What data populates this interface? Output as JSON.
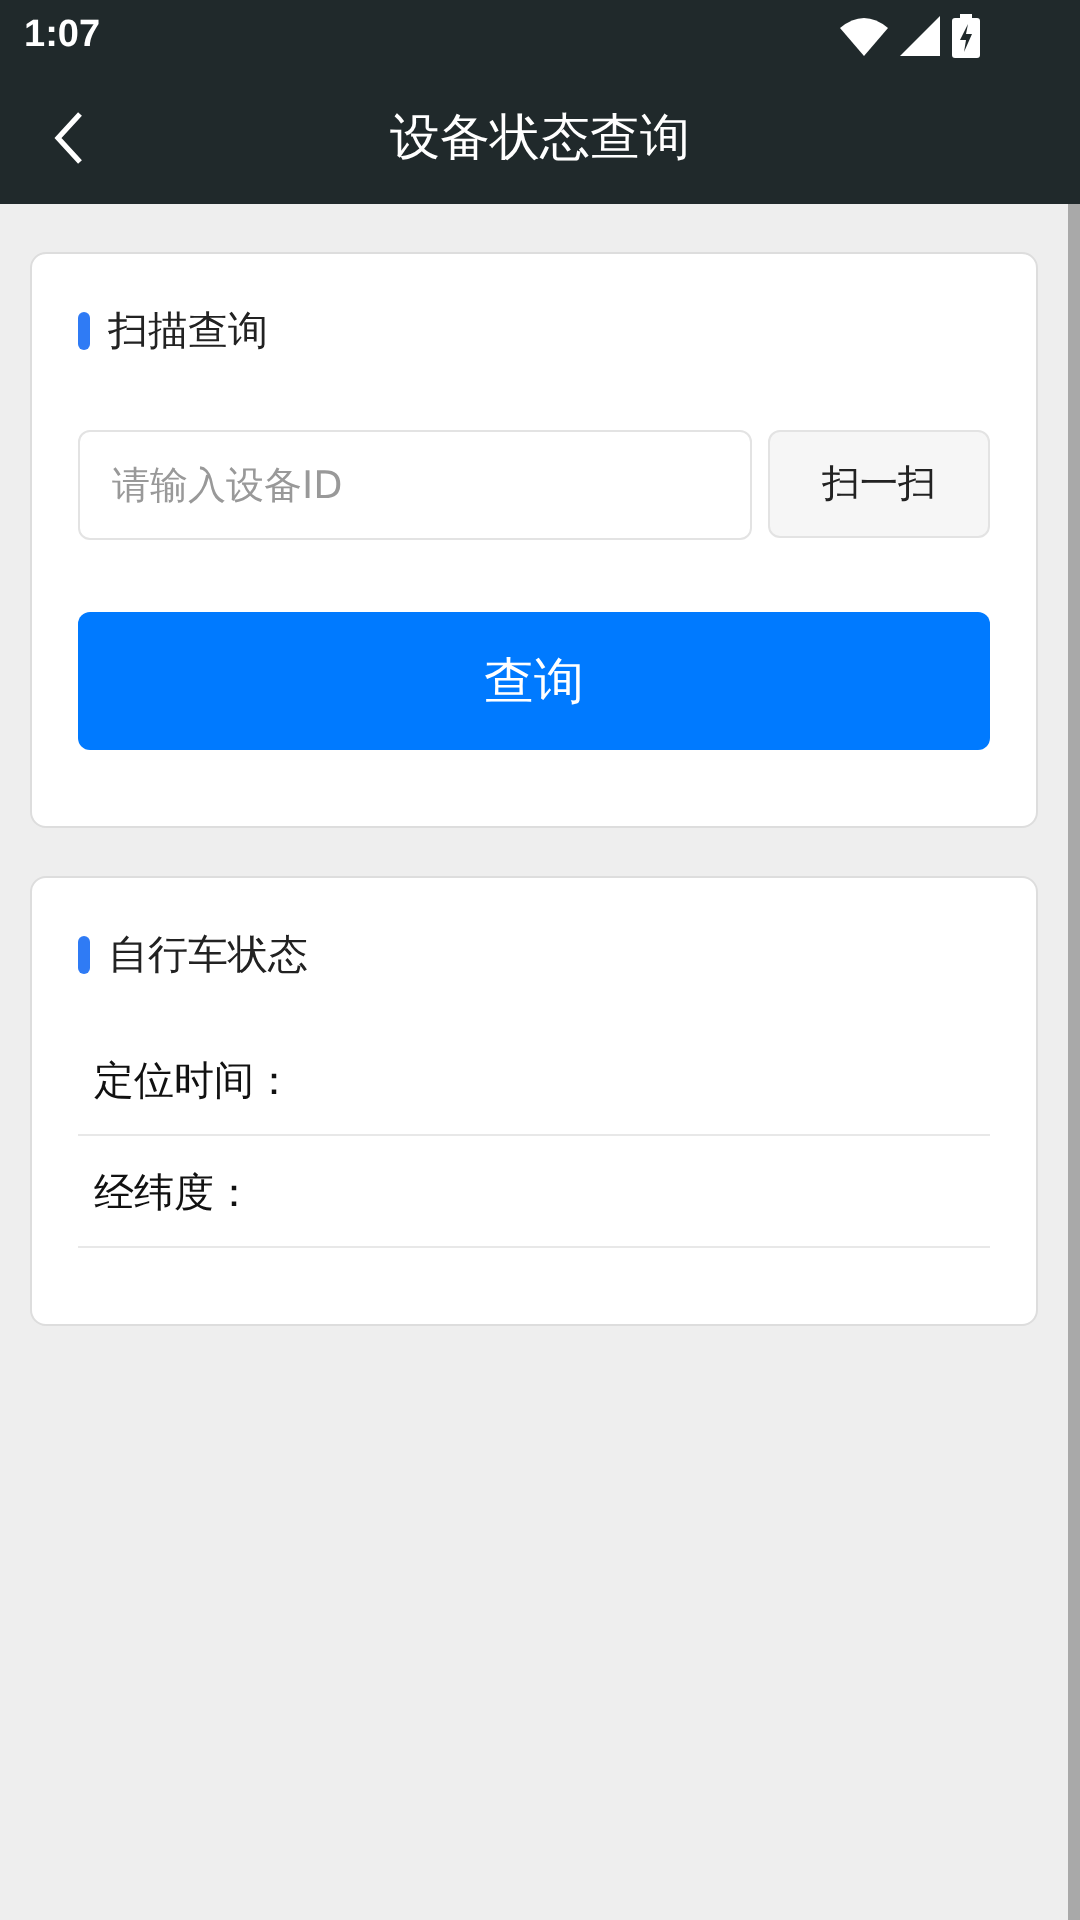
{
  "status_bar": {
    "time": "1:07"
  },
  "header": {
    "title": "设备状态查询"
  },
  "scan_card": {
    "title": "扫描查询",
    "placeholder": "请输入设备ID",
    "scan_button": "扫一扫",
    "query_button": "查询"
  },
  "status_card": {
    "title": "自行车状态",
    "fields": [
      {
        "label": "定位时间："
      },
      {
        "label": "经纬度："
      }
    ]
  }
}
